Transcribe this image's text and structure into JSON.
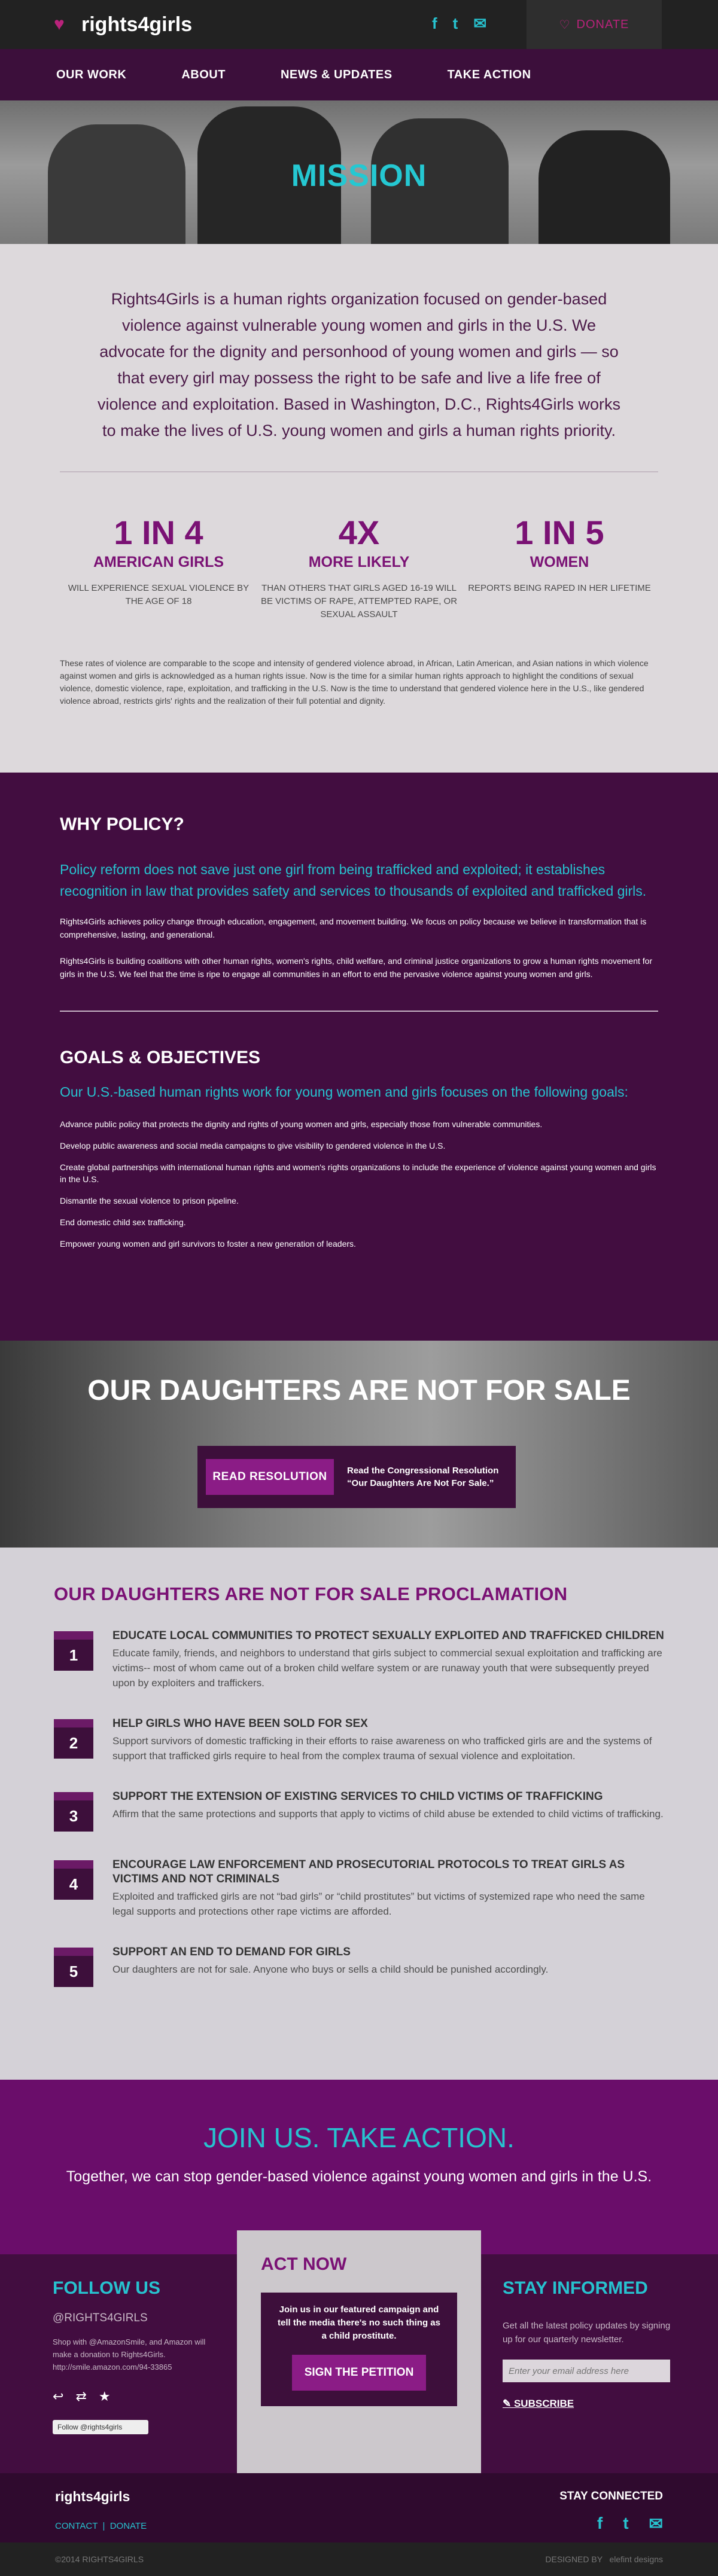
{
  "header": {
    "brand": "rights4girls",
    "donate_label": "DONATE",
    "social": [
      "f",
      "t",
      "✉"
    ]
  },
  "nav": {
    "items": [
      "OUR WORK",
      "ABOUT",
      "NEWS & UPDATES",
      "TAKE ACTION"
    ]
  },
  "hero": {
    "title": "MISSION"
  },
  "mission": {
    "text": "Rights4Girls is a human rights organization focused on gender-based violence against vulnerable young women and girls in the U.S. We advocate for the dignity and personhood of young women and girls — so that every girl may possess the right to be safe and live a life free of violence and exploitation. Based in Washington, D.C., Rights4Girls works to make the lives of U.S. young women and girls a human rights priority.",
    "stats": [
      {
        "num": "1 IN 4",
        "label": "AMERICAN GIRLS",
        "desc": "WILL EXPERIENCE SEXUAL VIOLENCE BY THE AGE OF 18"
      },
      {
        "num": "4X",
        "label": "MORE LIKELY",
        "desc": "THAN OTHERS THAT GIRLS AGED 16-19 WILL BE VICTIMS OF RAPE, ATTEMPTED RAPE, OR SEXUAL ASSAULT"
      },
      {
        "num": "1 IN 5",
        "label": "WOMEN",
        "desc": "REPORTS BEING RAPED IN HER LIFETIME"
      }
    ],
    "note": "These rates of violence are comparable to the scope and intensity of gendered violence abroad, in African, Latin American, and Asian nations in which violence against women and girls is acknowledged as a human rights issue. Now is the time for a similar human rights approach to highlight the conditions of sexual violence, domestic violence, rape, exploitation, and trafficking in the U.S. Now is the time to understand that gendered violence here in the U.S., like gendered violence abroad, restricts girls' rights and the realization of their full potential and dignity."
  },
  "policy": {
    "title": "WHY POLICY?",
    "lead": "Policy reform does not save just one girl from being trafficked and exploited; it establishes recognition in law that provides safety and services to thousands of exploited and trafficked girls.",
    "p1": "Rights4Girls achieves policy change through education, engagement, and movement building. We focus on policy because we believe in transformation that is comprehensive, lasting, and generational.",
    "p2": "Rights4Girls is building coalitions with other human rights, women's rights, child welfare, and criminal justice organizations to grow a human rights movement for girls in the U.S.  We feel that the time is ripe to engage all communities in an effort to end the pervasive violence against young women and girls."
  },
  "goals": {
    "title": "GOALS & OBJECTIVES",
    "lead": "Our U.S.-based human rights work for young women and girls focuses on the following goals:",
    "items": [
      "Advance public policy that protects the dignity and rights of young women and girls, especially those from vulnerable communities.",
      "Develop public awareness and social media campaigns to give visibility to gendered violence in the U.S.",
      "Create global partnerships with international human rights and women's rights organizations to include the experience of violence against young women and girls in the U.S.",
      "Dismantle the sexual violence to prison pipeline.",
      "End domestic child sex trafficking.",
      "Empower young women and girl survivors to foster a new generation of leaders."
    ]
  },
  "banner": {
    "title": "OUR DAUGHTERS ARE NOT FOR SALE",
    "button": "READ RESOLUTION",
    "text1": "Read the Congressional Resolution",
    "text2": "“Our Daughters Are Not For Sale.”"
  },
  "proclamation": {
    "title": "OUR DAUGHTERS ARE NOT FOR SALE PROCLAMATION",
    "items": [
      {
        "n": "1",
        "title": "EDUCATE LOCAL COMMUNITIES TO PROTECT SEXUALLY EXPLOITED AND TRAFFICKED CHILDREN",
        "text": "Educate family, friends, and neighbors to understand that girls subject to commercial sexual exploitation and trafficking are victims-- most of whom came out of a broken child welfare system or are runaway youth that were subsequently preyed upon by exploiters and traffickers."
      },
      {
        "n": "2",
        "title": "HELP GIRLS WHO HAVE BEEN SOLD FOR SEX",
        "text": "Support survivors of domestic trafficking in their efforts to raise awareness on who trafficked girls are and the systems of support that trafficked girls require to heal from the complex trauma of sexual violence and exploitation."
      },
      {
        "n": "3",
        "title": "SUPPORT THE EXTENSION OF EXISTING SERVICES TO CHILD VICTIMS OF TRAFFICKING",
        "text": "Affirm that the same protections and supports that apply to victims of child abuse be extended to child victims of trafficking."
      },
      {
        "n": "4",
        "title": "ENCOURAGE LAW ENFORCEMENT AND PROSECUTORIAL PROTOCOLS TO TREAT GIRLS AS VICTIMS AND NOT CRIMINALS",
        "text": "Exploited and trafficked girls are not “bad girls” or “child prostitutes” but victims of systemized rape who need the same legal supports and protections other rape victims are afforded."
      },
      {
        "n": "5",
        "title": "SUPPORT AN END TO DEMAND FOR GIRLS",
        "text": "Our daughters are not for sale. Anyone who buys or sells a child should be punished accordingly."
      }
    ]
  },
  "join": {
    "title": "JOIN US. TAKE ACTION.",
    "text": "Together, we can stop gender-based violence against young women and girls in the U.S."
  },
  "follow": {
    "title": "FOLLOW US",
    "handle": "@RIGHTS4GIRLS",
    "text": "Shop with @AmazonSmile, and Amazon will make a donation to Rights4Girls. http://smile.amazon.com/94-33865",
    "twitter_button": "Follow @rights4girls"
  },
  "act": {
    "title": "ACT NOW",
    "text": "Join us in our featured campaign and tell the media there's no such thing as a child prostitute.",
    "button": "SIGN THE PETITION"
  },
  "stay": {
    "title": "STAY INFORMED",
    "text": "Get all the latest policy updates by signing up for our quarterly newsletter.",
    "placeholder": "Enter your email address here",
    "subscribe": "SUBSCRIBE"
  },
  "footer": {
    "brand": "rights4girls",
    "contact": "CONTACT",
    "donate": "DONATE",
    "stay_connected": "STAY CONNECTED",
    "copyright": "©2014 RIGHTS4GIRLS",
    "designed_by": "DESIGNED BY",
    "designer": "elefint designs"
  }
}
